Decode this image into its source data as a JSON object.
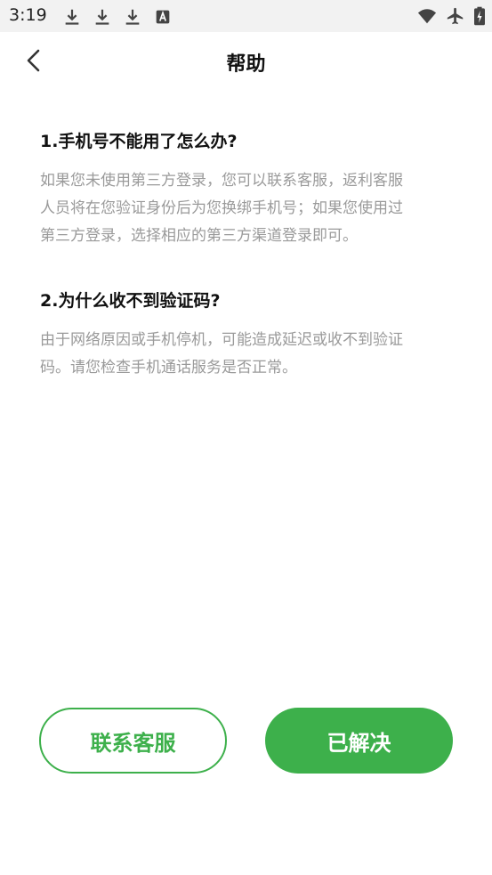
{
  "status_bar": {
    "time": "3:19",
    "left_icons": [
      "download-icon",
      "download-icon",
      "download-icon",
      "font-icon"
    ],
    "right_icons": [
      "wifi-icon",
      "airplane-icon",
      "battery-charging-icon"
    ]
  },
  "header": {
    "title": "帮助",
    "back_icon": "chevron-left-icon"
  },
  "faq": [
    {
      "question": "1.手机号不能用了怎么办?",
      "answer_lines": [
        "如果您未使用第三方登录，您可以联系客服，返利客服",
        "人员将在您验证身份后为您换绑手机号；如果您使用过",
        "第三方登录，选择相应的第三方渠道登录即可。"
      ]
    },
    {
      "question": "2.为什么收不到验证码?",
      "answer_lines": [
        "由于网络原因或手机停机，可能造成延迟或收不到验证",
        "码。请您检查手机通话服务是否正常。"
      ]
    }
  ],
  "buttons": {
    "contact_label": "联系客服",
    "resolved_label": "已解决"
  },
  "colors": {
    "accent": "#3db04b",
    "answer_text": "#9a9a9a",
    "status_bar_bg": "#f2f2f2"
  }
}
